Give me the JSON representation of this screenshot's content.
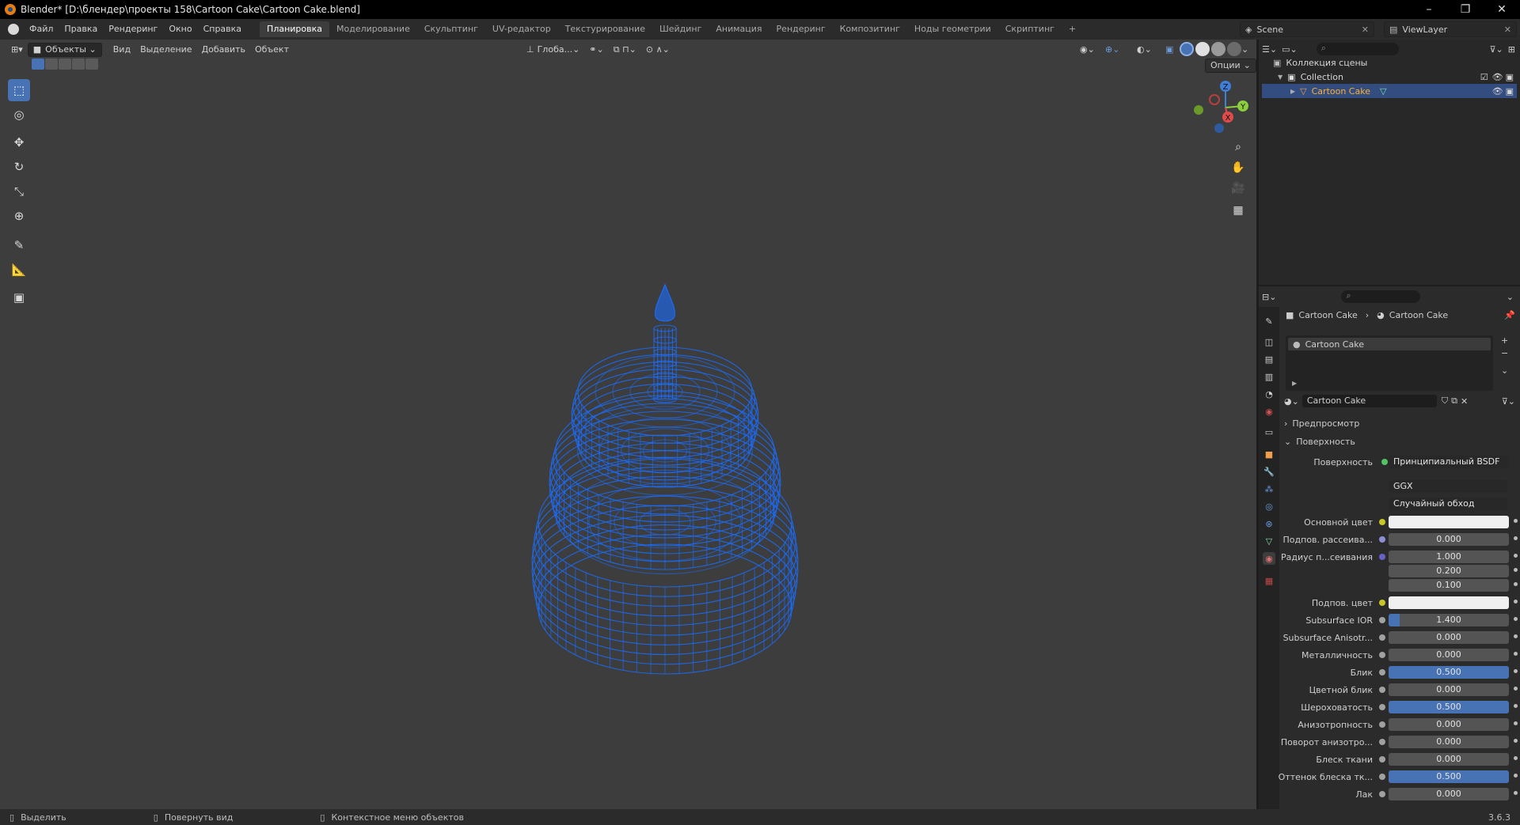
{
  "window": {
    "title": "Blender* [D:\\блендер\\проекты 158\\Cartoon Cake\\Cartoon Cake.blend]",
    "minimize": "–",
    "maximize": "❐",
    "close": "✕"
  },
  "menu": {
    "items": [
      "Файл",
      "Правка",
      "Рендеринг",
      "Окно",
      "Справка"
    ]
  },
  "workspaces": {
    "tabs": [
      "Планировка",
      "Моделирование",
      "Скульптинг",
      "UV-редактор",
      "Текстурирование",
      "Шейдинг",
      "Анимация",
      "Рендеринг",
      "Композитинг",
      "Ноды геометрии",
      "Скриптинг"
    ],
    "active": "Планировка",
    "add": "+"
  },
  "scene": {
    "name": "Scene",
    "view_layer": "ViewLayer"
  },
  "viewport_header": {
    "mode": "Объекты",
    "menus": [
      "Вид",
      "Выделение",
      "Добавить",
      "Объект"
    ],
    "orientation": "Глоба...",
    "options": "Опции"
  },
  "viewport": {
    "mesh_color": "#1a6dff",
    "gizmo": {
      "z": "Z",
      "y": "Y",
      "x": "X"
    }
  },
  "outliner": {
    "scene_collection": "Коллекция сцены",
    "collection": "Collection",
    "object": "Cartoon Cake"
  },
  "properties": {
    "breadcrumb_object": "Cartoon Cake",
    "breadcrumb_material": "Cartoon Cake",
    "slot": "Cartoon Cake",
    "material_name": "Cartoon Cake",
    "panel_preview": "Предпросмотр",
    "panel_surface": "Поверхность",
    "surface_label": "Поверхность",
    "surface_value": "Принципиальный BSDF",
    "distribution": "GGX",
    "subsurface_method": "Случайный обход",
    "rows": [
      {
        "label": "Основной цвет",
        "value": "",
        "type": "color",
        "dot": "#c7c729"
      },
      {
        "label": "Подпов. рассеива...",
        "value": "0.000",
        "type": "num",
        "fill": 0,
        "dot": "#8d8dd6"
      },
      {
        "label": "Радиус п...сеивания",
        "value": "1.000",
        "type": "num",
        "fill": 0,
        "dot": "#6363c7"
      },
      {
        "label": "",
        "value": "0.200",
        "type": "num",
        "fill": 0,
        "dot": ""
      },
      {
        "label": "",
        "value": "0.100",
        "type": "num",
        "fill": 0,
        "dot": ""
      },
      {
        "label": "Подпов. цвет",
        "value": "",
        "type": "color",
        "dot": "#c7c729"
      },
      {
        "label": "Subsurface IOR",
        "value": "1.400",
        "type": "num",
        "fill": 0.09,
        "dot": "#a1a1a1"
      },
      {
        "label": "Subsurface Anisotr...",
        "value": "0.000",
        "type": "num",
        "fill": 0,
        "dot": "#a1a1a1"
      },
      {
        "label": "Металличность",
        "value": "0.000",
        "type": "num",
        "fill": 0,
        "dot": "#a1a1a1"
      },
      {
        "label": "Блик",
        "value": "0.500",
        "type": "num",
        "fill": 1,
        "dot": "#a1a1a1"
      },
      {
        "label": "Цветной блик",
        "value": "0.000",
        "type": "num",
        "fill": 0,
        "dot": "#a1a1a1"
      },
      {
        "label": "Шероховатость",
        "value": "0.500",
        "type": "num",
        "fill": 1,
        "dot": "#a1a1a1"
      },
      {
        "label": "Анизотропность",
        "value": "0.000",
        "type": "num",
        "fill": 0,
        "dot": "#a1a1a1"
      },
      {
        "label": "Поворот анизотро...",
        "value": "0.000",
        "type": "num",
        "fill": 0,
        "dot": "#a1a1a1"
      },
      {
        "label": "Блеск ткани",
        "value": "0.000",
        "type": "num",
        "fill": 0,
        "dot": "#a1a1a1"
      },
      {
        "label": "Оттенок блеска тк...",
        "value": "0.500",
        "type": "num",
        "fill": 1,
        "dot": "#a1a1a1"
      },
      {
        "label": "Лак",
        "value": "0.000",
        "type": "num",
        "fill": 0,
        "dot": "#a1a1a1"
      }
    ]
  },
  "statusbar": {
    "select": "Выделить",
    "rotate": "Повернуть вид",
    "context": "Контекстное меню объектов",
    "version": "3.6.3"
  }
}
